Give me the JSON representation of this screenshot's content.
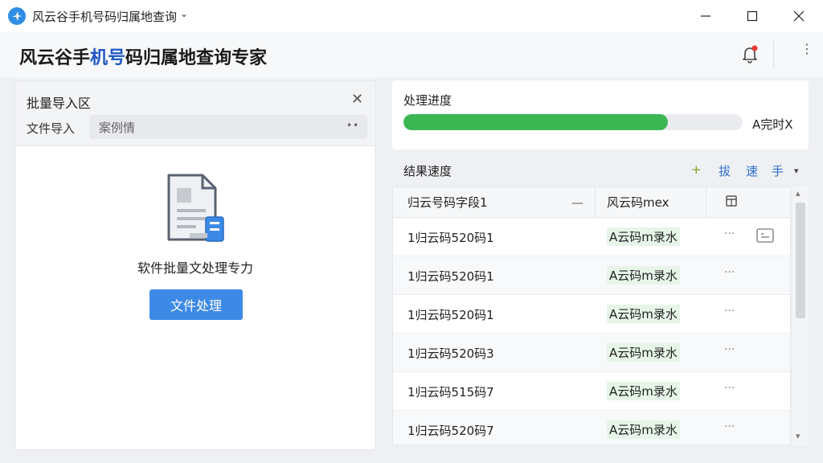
{
  "window": {
    "title": "风云谷手机号码归属地查询",
    "chevron": "⌄",
    "minimize": "—",
    "maximize": "☐",
    "close": "✕"
  },
  "header": {
    "title_part1": "风云谷手",
    "title_highlight": "机号",
    "title_part2": "码归属地查询专家",
    "menu": "⋮"
  },
  "left_panel": {
    "title": "批量导入区",
    "close": "✕",
    "file_label": "文件导入",
    "file_value": "案例情",
    "file_dots": "••",
    "drop_text": "软件批量文处理专力",
    "process_button": "文件处理"
  },
  "progress": {
    "title": "处理进度",
    "percent": 78,
    "status": "A完时X"
  },
  "results": {
    "title": "结果速度",
    "toolbar": [
      "+",
      "拔",
      "速",
      "手",
      "▾"
    ],
    "columns": [
      "归云号码字段1",
      "风云码mex",
      ""
    ],
    "col1_sort": "—",
    "rows": [
      {
        "number": "1归云码520码1",
        "result": "A云码m录水",
        "more": "···",
        "has_action": true
      },
      {
        "number": "1归云码520码1",
        "result": "A云码m录水",
        "more": "···",
        "has_action": false
      },
      {
        "number": "1归云码520码1",
        "result": "A云码m录水",
        "more": "···",
        "has_action": false
      },
      {
        "number": "1归云码520码3",
        "result": "A云码m录水",
        "more": "···",
        "has_action": false
      },
      {
        "number": "1归云码515码7",
        "result": "A云码m录水",
        "more": "···",
        "has_action": false
      },
      {
        "number": "1归云码520码7",
        "result": "A云码m录水",
        "more": "···",
        "has_action": false
      }
    ],
    "scroll_up": "▴",
    "scroll_down": "▾"
  },
  "colors": {
    "accent_blue": "#3d8ae6",
    "title_highlight": "#1f56c4",
    "progress_green": "#3cb653"
  }
}
